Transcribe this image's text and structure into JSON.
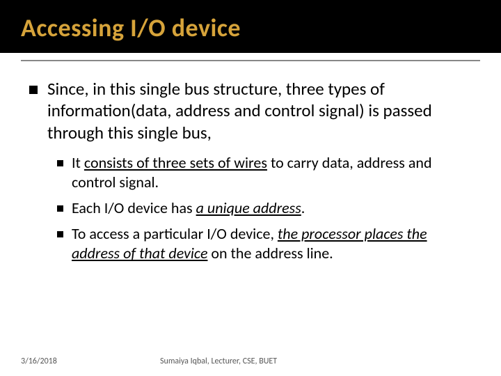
{
  "title": "Accessing I/O device",
  "main": {
    "text": "Since, in this single bus structure, three types of information(data, address and control signal) is passed through this single bus,"
  },
  "subs": {
    "s1_pre": "It ",
    "s1_u": "consists of three sets of wires",
    "s1_post": " to carry data, address and control signal.",
    "s2_pre": "Each I/O device has ",
    "s2_u": "a unique address",
    "s2_post": ".",
    "s3_pre": "To access a particular I/O device, ",
    "s3_u": "the processor places the address of that device",
    "s3_post": " on the address line."
  },
  "footer": {
    "date": "3/16/2018",
    "author": "Sumaiya Iqbal, Lecturer, CSE, BUET"
  }
}
